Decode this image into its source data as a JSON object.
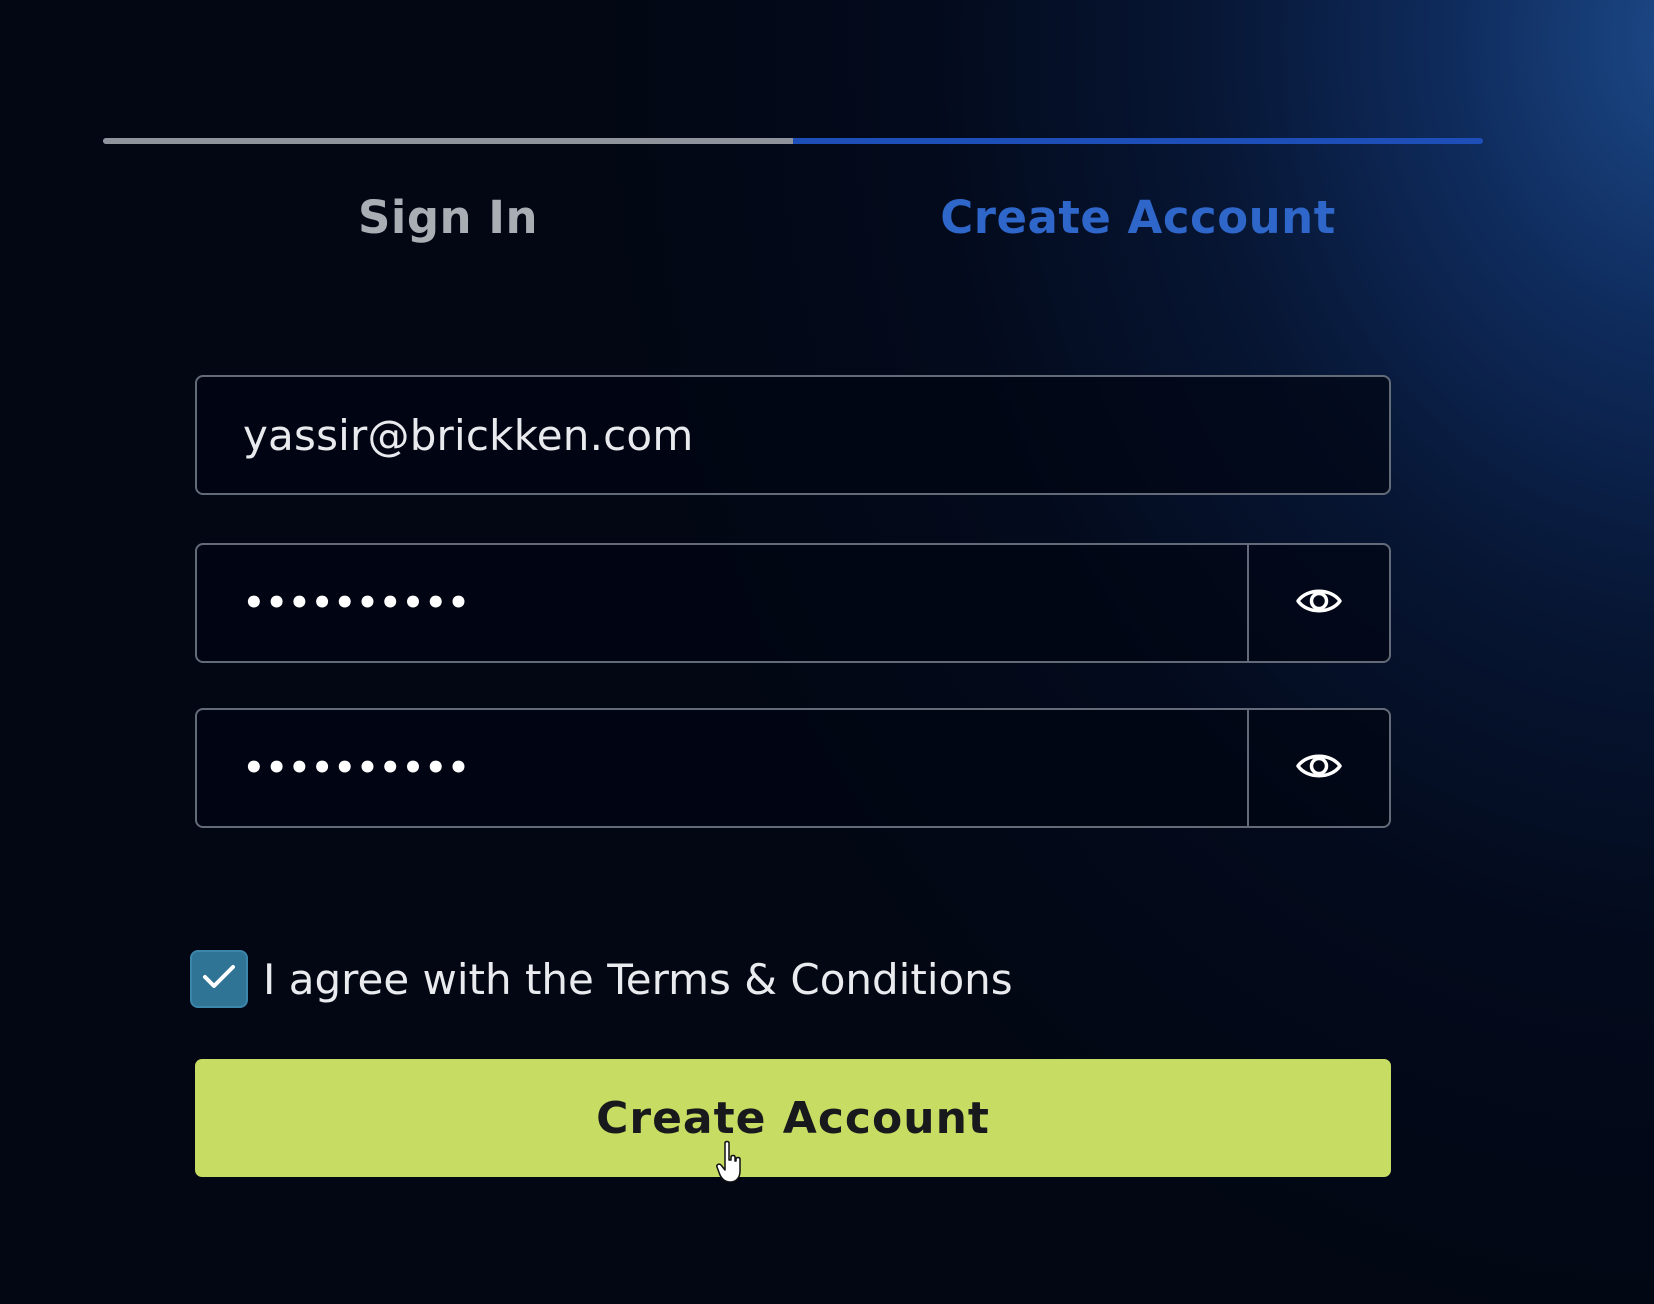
{
  "tabs": {
    "sign_in_label": "Sign In",
    "create_account_label": "Create Account",
    "active": "Create Account"
  },
  "form": {
    "email_value": "yassir@brickken.com",
    "password_value": "••••••••••",
    "confirm_password_value": "••••••••••",
    "terms_checked": true,
    "terms_label": "I agree with the Terms & Conditions",
    "submit_label": "Create Account"
  },
  "icons": {
    "password_toggle": "eye-icon",
    "confirm_password_toggle": "eye-icon",
    "checkbox_mark": "check-icon",
    "pointer": "hand-cursor-icon"
  },
  "colors": {
    "active_tab": "#2f66c9",
    "inactive_tab": "#a9adb4",
    "tab_indicator_active": "#1e4fb9",
    "tab_indicator_inactive": "#8f949c",
    "checkbox": "#2f7395",
    "submit_button": "#c6dc62",
    "submit_text": "#17191c"
  }
}
